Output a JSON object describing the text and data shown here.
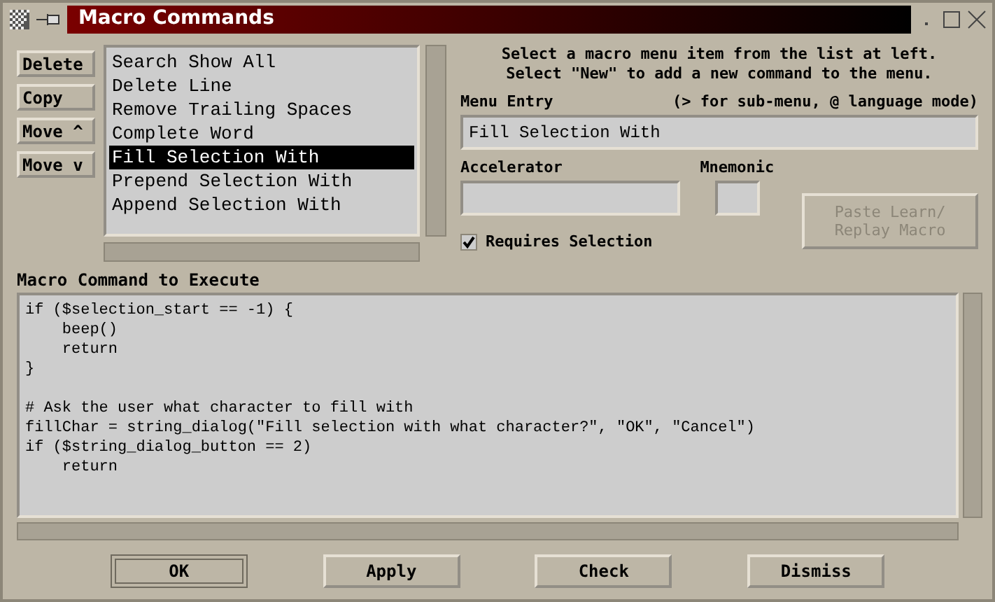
{
  "window": {
    "title": "Macro Commands"
  },
  "side_buttons": [
    "Delete",
    "Copy",
    "Move ^",
    "Move v"
  ],
  "menu_list": [
    {
      "label": "Search Show All",
      "selected": false
    },
    {
      "label": "Delete Line",
      "selected": false
    },
    {
      "label": "Remove Trailing Spaces",
      "selected": false
    },
    {
      "label": "Complete Word",
      "selected": false
    },
    {
      "label": "Fill Selection With",
      "selected": true
    },
    {
      "label": "Prepend Selection With",
      "selected": false
    },
    {
      "label": "Append Selection With",
      "selected": false
    }
  ],
  "instructions": [
    "Select a macro menu item from the list at left.",
    "Select \"New\" to add a new command to the menu."
  ],
  "menu_entry": {
    "label": "Menu Entry",
    "hint": "(> for sub-menu, @ language mode)",
    "value": "Fill Selection With"
  },
  "accelerator": {
    "label": "Accelerator"
  },
  "mnemonic": {
    "label": "Mnemonic"
  },
  "paste_button": {
    "label": "Paste Learn/\nReplay Macro",
    "disabled": true
  },
  "requires_selection": {
    "label": "Requires Selection",
    "checked": true
  },
  "command": {
    "label": "Macro Command to Execute",
    "code": "if ($selection_start == -1) {\n    beep()\n    return\n}\n\n# Ask the user what character to fill with\nfillChar = string_dialog(\"Fill selection with what character?\", \"OK\", \"Cancel\")\nif ($string_dialog_button == 2)\n    return"
  },
  "buttons": [
    {
      "label": "OK",
      "default": true
    },
    {
      "label": "Apply",
      "default": false
    },
    {
      "label": "Check",
      "default": false
    },
    {
      "label": "Dismiss",
      "default": false
    }
  ]
}
